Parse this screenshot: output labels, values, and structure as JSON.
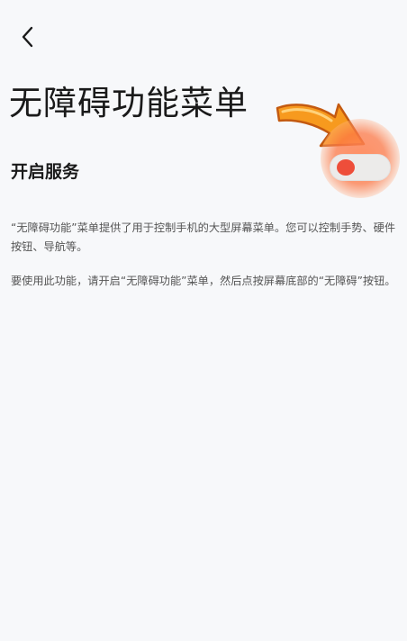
{
  "header": {
    "back_icon": "chevron-left-icon"
  },
  "page": {
    "title": "无障碍功能菜单"
  },
  "service": {
    "label": "开启服务",
    "toggle_state": "off",
    "toggle_knob_color": "#ee4e3a",
    "highlight_color": "#fb7a46"
  },
  "annotation": {
    "arrow_icon": "arrow-pointer-icon",
    "arrow_color": "#f79a1e"
  },
  "description": {
    "paragraph_1": "“无障碍功能”菜单提供了用于控制手机的大型屏幕菜单。您可以控制手势、硬件按钮、导航等。",
    "paragraph_2": "要使用此功能，请开启“无障碍功能”菜单，然后点按屏幕底部的“无障碍”按钮。"
  }
}
